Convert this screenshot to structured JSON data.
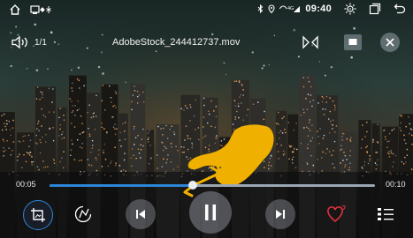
{
  "status_bar": {
    "time": "09:40",
    "signal_text": "4G",
    "icons": [
      "home-icon",
      "notification-icons",
      "bluetooth-icon",
      "location-icon",
      "signal-icon",
      "brightness-icon",
      "recent-apps-icon",
      "back-icon"
    ]
  },
  "player": {
    "file_name": "AdobeStock_244412737.mov",
    "track_counter": "1/1",
    "elapsed_time": "00:05",
    "total_time": "00:10",
    "progress_fraction": 0.44,
    "state": "playing"
  },
  "colors": {
    "accent": "#2c86d8",
    "favorite": "#e0313c",
    "gesture_hand": "#f0b000"
  },
  "controls": [
    "crop-icon",
    "edit-icon",
    "previous-icon",
    "pause-icon",
    "next-icon",
    "favorite-icon",
    "playlist-icon"
  ]
}
